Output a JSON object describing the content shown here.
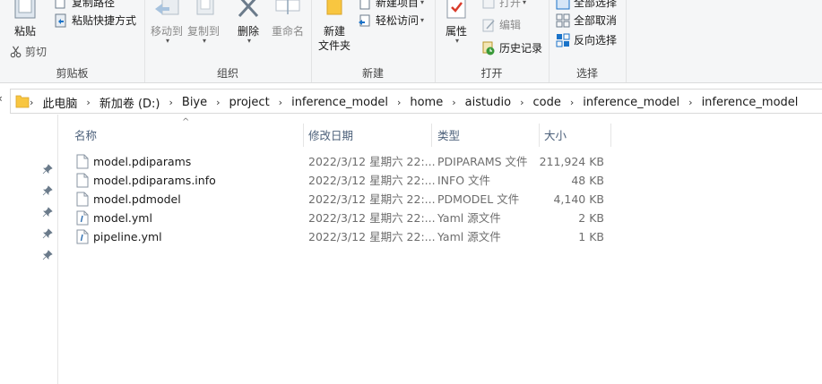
{
  "ribbon": {
    "clipboard": {
      "label": "剪贴板",
      "paste": "粘贴",
      "copy_path": "复制路径",
      "paste_shortcut": "粘贴快捷方式",
      "cut": "剪切"
    },
    "organize": {
      "label": "组织",
      "move_to": "移动到",
      "copy_to": "复制到",
      "delete": "删除",
      "rename": "重命名"
    },
    "new": {
      "label": "新建",
      "new_folder": "新建\n文件夹",
      "new_item": "新建项目",
      "easy_access": "轻松访问"
    },
    "open": {
      "label": "打开",
      "properties": "属性",
      "open": "打开",
      "edit": "编辑",
      "history": "历史记录"
    },
    "select": {
      "label": "选择",
      "select_all_partial": "全部选择",
      "select_none": "全部取消",
      "invert": "反向选择"
    }
  },
  "address": {
    "crumbs": [
      "此电脑",
      "新加卷 (D:)",
      "Biye",
      "project",
      "inference_model",
      "home",
      "aistudio",
      "code",
      "inference_model",
      "inference_model"
    ]
  },
  "columns": {
    "name": "名称",
    "date": "修改日期",
    "type": "类型",
    "size": "大小"
  },
  "files": [
    {
      "name": "model.pdiparams",
      "date": "2022/3/12 星期六 22:...",
      "type": "PDIPARAMS 文件",
      "size": "211,924 KB",
      "icon": "file-icon"
    },
    {
      "name": "model.pdiparams.info",
      "date": "2022/3/12 星期六 22:...",
      "type": "INFO 文件",
      "size": "48 KB",
      "icon": "file-icon"
    },
    {
      "name": "model.pdmodel",
      "date": "2022/3/12 星期六 22:...",
      "type": "PDMODEL 文件",
      "size": "4,140 KB",
      "icon": "file-icon"
    },
    {
      "name": "model.yml",
      "date": "2022/3/12 星期六 22:...",
      "type": "Yaml 源文件",
      "size": "2 KB",
      "icon": "yaml-file-icon"
    },
    {
      "name": "pipeline.yml",
      "date": "2022/3/12 星期六 22:...",
      "type": "Yaml 源文件",
      "size": "1 KB",
      "icon": "yaml-file-icon"
    }
  ],
  "colors": {
    "ribbon_bg": "#f5f6f7",
    "header_text": "#4c607a",
    "folder_yellow": "#f8c640",
    "accent_blue": "#1a73c9"
  }
}
